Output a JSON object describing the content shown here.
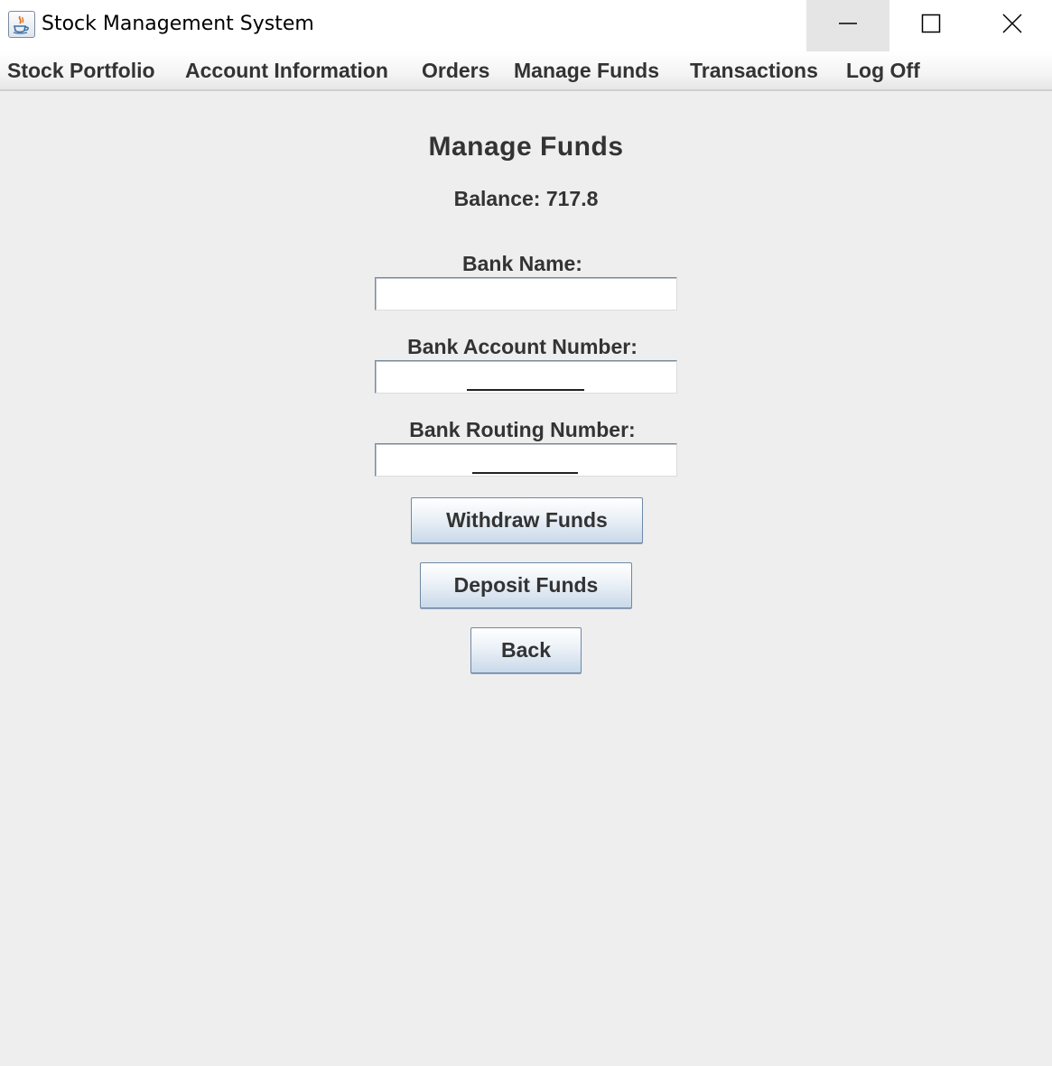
{
  "window": {
    "title": "Stock Management System",
    "app_icon": "java-coffee-icon",
    "controls": {
      "minimize": "minimize-icon",
      "maximize": "maximize-icon",
      "close": "close-icon"
    }
  },
  "menu": {
    "items": [
      {
        "label": "Stock Portfolio"
      },
      {
        "label": "Account Information"
      },
      {
        "label": "Orders"
      },
      {
        "label": "Manage Funds"
      },
      {
        "label": "Transactions"
      },
      {
        "label": "Log Off"
      }
    ]
  },
  "main": {
    "heading": "Manage Funds",
    "balance": "Balance: 717.8",
    "bank_name": {
      "label": "Bank Name:",
      "value": ""
    },
    "account_number": {
      "label": "Bank Account Number:",
      "value": ""
    },
    "routing_number": {
      "label": "Bank Routing Number:",
      "value": ""
    },
    "buttons": {
      "withdraw": "Withdraw Funds",
      "deposit": "Deposit Funds",
      "back": "Back"
    }
  },
  "colors": {
    "background": "#eeeeee",
    "text": "#333333",
    "button_border": "#6e88a6"
  }
}
